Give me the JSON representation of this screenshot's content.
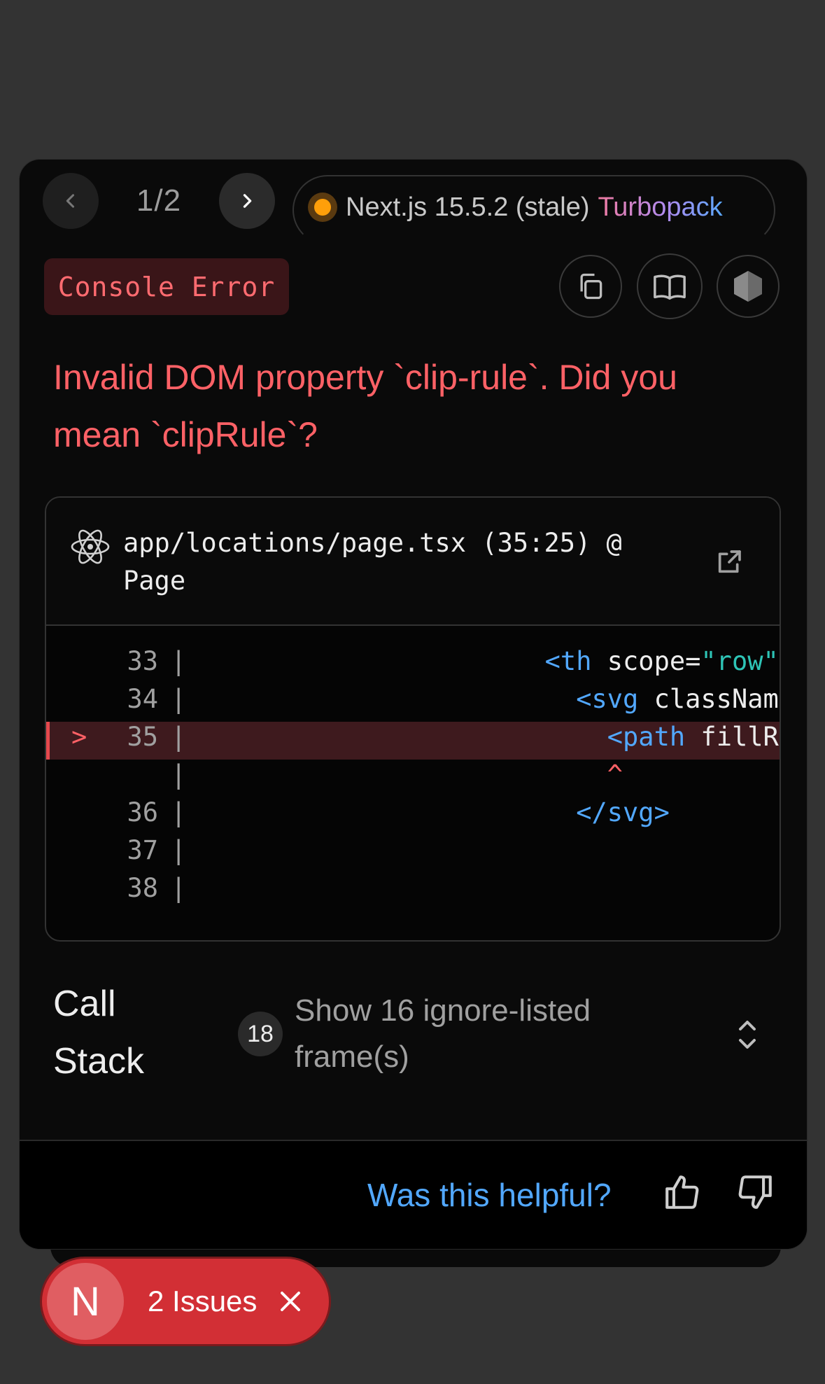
{
  "nav": {
    "pager": "1/2"
  },
  "version": {
    "label": "Next.js 15.5.2 (stale)",
    "bundler": "Turbopack"
  },
  "error": {
    "type": "Console Error",
    "message": "Invalid DOM property `clip-rule`. Did you mean `clipRule`?"
  },
  "frame": {
    "path_line1": "app/locations/page.tsx (35:25) @",
    "path_line2": "Page"
  },
  "code": {
    "lines": [
      {
        "num": "33",
        "marker": "",
        "sep": "|",
        "pre": "                      ",
        "tag": "<th",
        "attr": " scope=",
        "str": "\"row\"",
        "post": ""
      },
      {
        "num": "34",
        "marker": "",
        "sep": "|",
        "pre": "                        ",
        "tag": "<svg",
        "attr": " classNam",
        "str": "",
        "post": ""
      },
      {
        "num": "35",
        "marker": ">",
        "sep": "|",
        "pre": "                          ",
        "tag": "<path",
        "attr": " fillR",
        "str": "",
        "post": ""
      },
      {
        "num": "",
        "marker": "",
        "sep": "|",
        "pre": "                          ",
        "tag": "",
        "attr": "",
        "str": "",
        "post": "",
        "caret": "^"
      },
      {
        "num": "36",
        "marker": "",
        "sep": "|",
        "pre": "                        ",
        "tag": "</svg>",
        "attr": "",
        "str": "",
        "post": ""
      },
      {
        "num": "37",
        "marker": "",
        "sep": "|",
        "pre": "",
        "tag": "",
        "attr": "",
        "str": "",
        "post": ""
      },
      {
        "num": "38",
        "marker": "",
        "sep": "|",
        "pre": "",
        "tag": "",
        "attr": "",
        "str": "",
        "post": ""
      }
    ]
  },
  "callstack": {
    "title_line1": "Call",
    "title_line2": "Stack",
    "count": "18",
    "ignore_line1": "Show 16 ignore-listed",
    "ignore_line2": "frame(s)"
  },
  "footer": {
    "helpful": "Was this helpful?"
  },
  "issues": {
    "logo": "N",
    "label": "2 Issues"
  },
  "colors": {
    "error": "#ff6166",
    "link": "#52a8ff",
    "badge": "#d22f35",
    "warning_dot": "#ff9f0a"
  }
}
